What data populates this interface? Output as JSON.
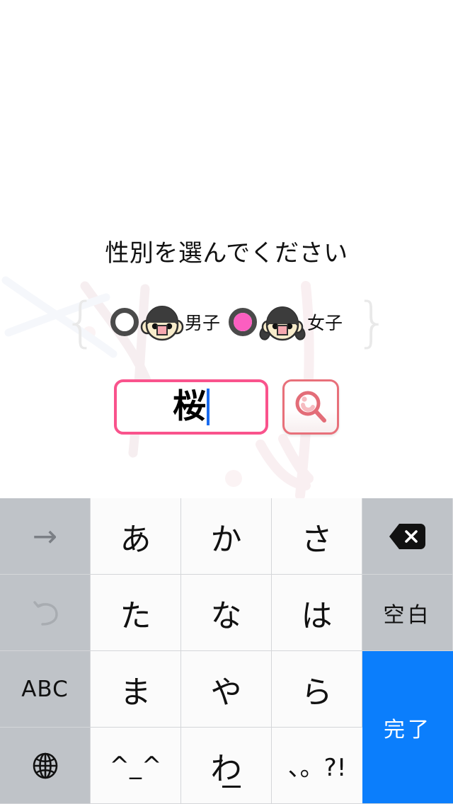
{
  "screen": {
    "title": "性別を選んでください",
    "background_color": "#ffffff"
  },
  "colors": {
    "accent_pink": "#fb5ec0",
    "input_border_pink": "#f9538c",
    "search_border": "#e8707a",
    "key_gray": "#bfc3c8",
    "key_light": "#fbfbfb",
    "enter_blue": "#0b7efc",
    "brace_gray": "#e9e9e9",
    "caret_blue": "#1a6cf0"
  },
  "gender_selector": {
    "brace_left": "{",
    "brace_right": "}",
    "options": [
      {
        "label": "男子",
        "selected": false,
        "avatar": "boy-face-icon"
      },
      {
        "label": "女子",
        "selected": true,
        "avatar": "girl-face-icon"
      }
    ]
  },
  "name_input": {
    "value": "桜",
    "placeholder": "",
    "has_caret": true
  },
  "search_button": {
    "icon": "magnifier-icon",
    "label": ""
  },
  "keyboard": {
    "rows": [
      [
        {
          "label": "→",
          "type": "fn",
          "name": "key-cursor-right",
          "icon": "arrow-right-icon"
        },
        {
          "label": "あ",
          "type": "char",
          "name": "key-a"
        },
        {
          "label": "か",
          "type": "char",
          "name": "key-ka"
        },
        {
          "label": "さ",
          "type": "char",
          "name": "key-sa"
        },
        {
          "label": "",
          "type": "fn",
          "name": "key-delete",
          "icon": "delete-icon"
        }
      ],
      [
        {
          "label": "↺",
          "type": "fn",
          "name": "key-undo",
          "icon": "undo-icon"
        },
        {
          "label": "た",
          "type": "char",
          "name": "key-ta"
        },
        {
          "label": "な",
          "type": "char",
          "name": "key-na"
        },
        {
          "label": "は",
          "type": "char",
          "name": "key-ha"
        },
        {
          "label": "空白",
          "type": "fn",
          "name": "key-space"
        }
      ],
      [
        {
          "label": "ABC",
          "type": "fn",
          "name": "key-abc"
        },
        {
          "label": "ま",
          "type": "char",
          "name": "key-ma"
        },
        {
          "label": "や",
          "type": "char",
          "name": "key-ya"
        },
        {
          "label": "ら",
          "type": "char",
          "name": "key-ra"
        },
        {
          "label": "完了",
          "type": "enter",
          "name": "key-done"
        }
      ],
      [
        {
          "label": "",
          "type": "fn",
          "name": "key-globe",
          "icon": "globe-icon"
        },
        {
          "label": "^_^",
          "type": "char",
          "name": "key-kaomoji"
        },
        {
          "label": "わ",
          "type": "char",
          "name": "key-wa"
        },
        {
          "label": "、。?!",
          "type": "char",
          "name": "key-punctuation"
        }
      ]
    ]
  }
}
